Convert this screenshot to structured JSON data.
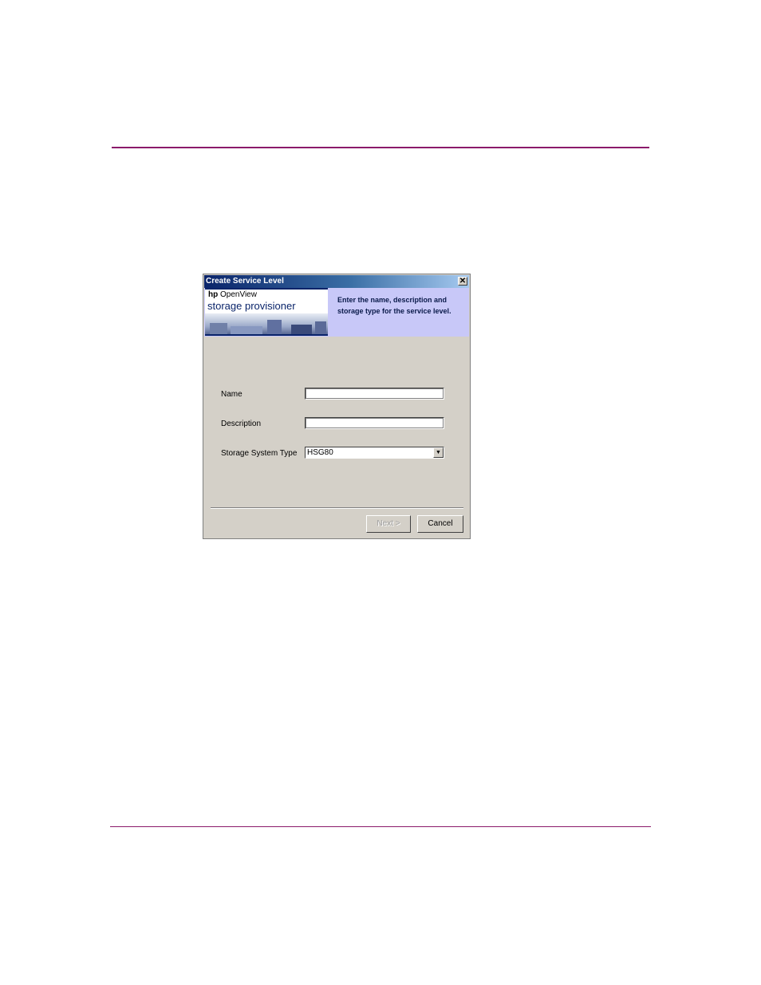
{
  "dialog": {
    "title": "Create Service Level",
    "close_glyph": "✕",
    "banner": {
      "logo_hp": "hp",
      "logo_product": "OpenView",
      "logo_subtitle": "storage provisioner",
      "instructions": "Enter the name, description and storage type for the service level."
    },
    "form": {
      "name_label": "Name",
      "name_value": "",
      "description_label": "Description",
      "description_value": "",
      "storage_type_label": "Storage System Type",
      "storage_type_value": "HSG80",
      "dropdown_glyph": "▼"
    },
    "buttons": {
      "next_label": "Next >",
      "cancel_label": "Cancel"
    },
    "colors": {
      "titlebar_start": "#0a246a",
      "titlebar_end": "#a6caf0",
      "banner_bg": "#c8c8f8",
      "dialog_bg": "#d4d0c8",
      "rule": "#8b1a6b"
    }
  }
}
